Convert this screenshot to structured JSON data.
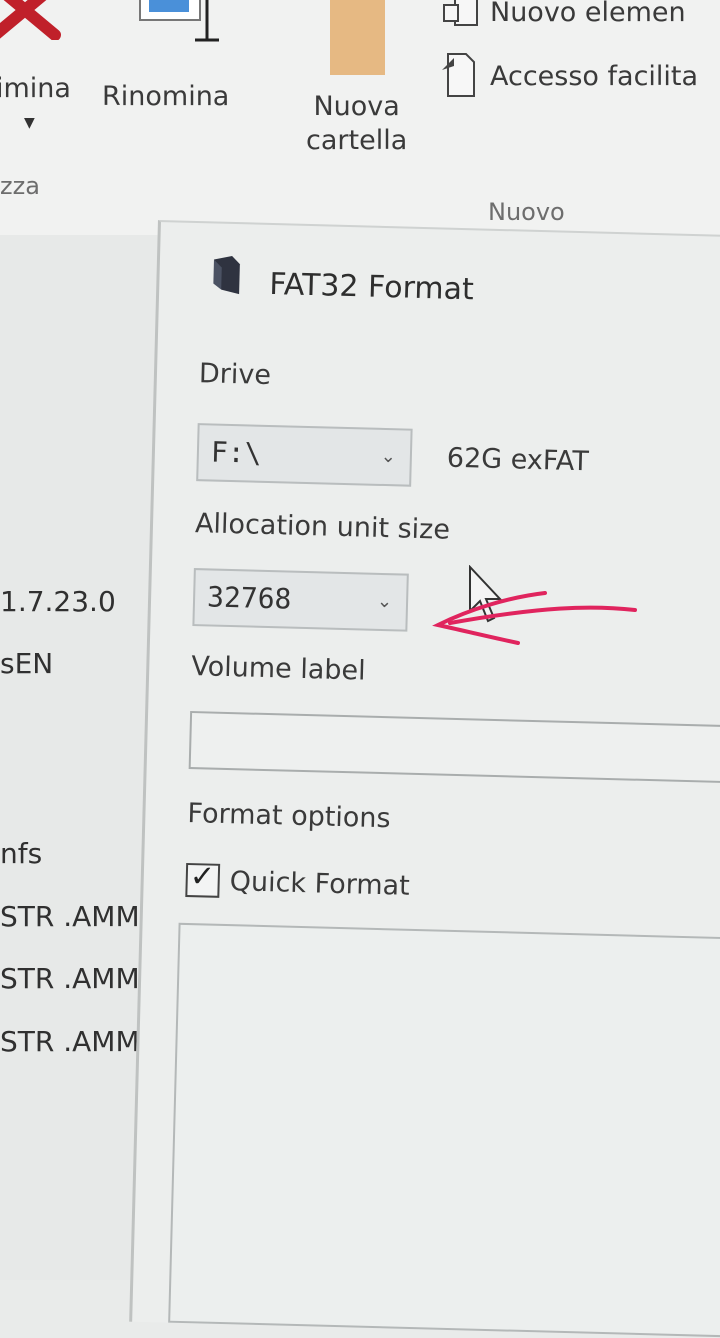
{
  "ribbon": {
    "delete_label": "imina",
    "rename_label": "Rinomina",
    "newfolder_label_1": "Nuova",
    "newfolder_label_2": "cartella",
    "new_item_label": "Nuovo elemen",
    "easy_access_label": "Accesso facilita",
    "group_organize": "zza",
    "group_new": "Nuovo"
  },
  "file_list": {
    "version": "1.7.23.0",
    "lang": "sEN",
    "type_a": "nfs",
    "rows": [
      "STR .AMM",
      "STR .AMM",
      "STR .AMM"
    ]
  },
  "dialog": {
    "title": "FAT32 Format",
    "drive_label": "Drive",
    "drive_value": "F:\\",
    "drive_info": "62G exFAT",
    "alloc_label": "Allocation unit size",
    "alloc_value": "32768",
    "volume_label": "Volume label",
    "volume_value": "",
    "format_options_label": "Format options",
    "quick_format_label": "Quick Format",
    "quick_format_checked": true
  },
  "icons": [
    "delete-icon",
    "rename-icon",
    "new-folder-icon",
    "new-item-icon",
    "easy-access-icon",
    "drive-icon",
    "chevron-down-icon",
    "mouse-cursor-icon",
    "red-arrow-annotation"
  ],
  "colors": {
    "annotation": "#e0245e",
    "delete_red": "#c0202a",
    "folder": "#e6b983"
  }
}
